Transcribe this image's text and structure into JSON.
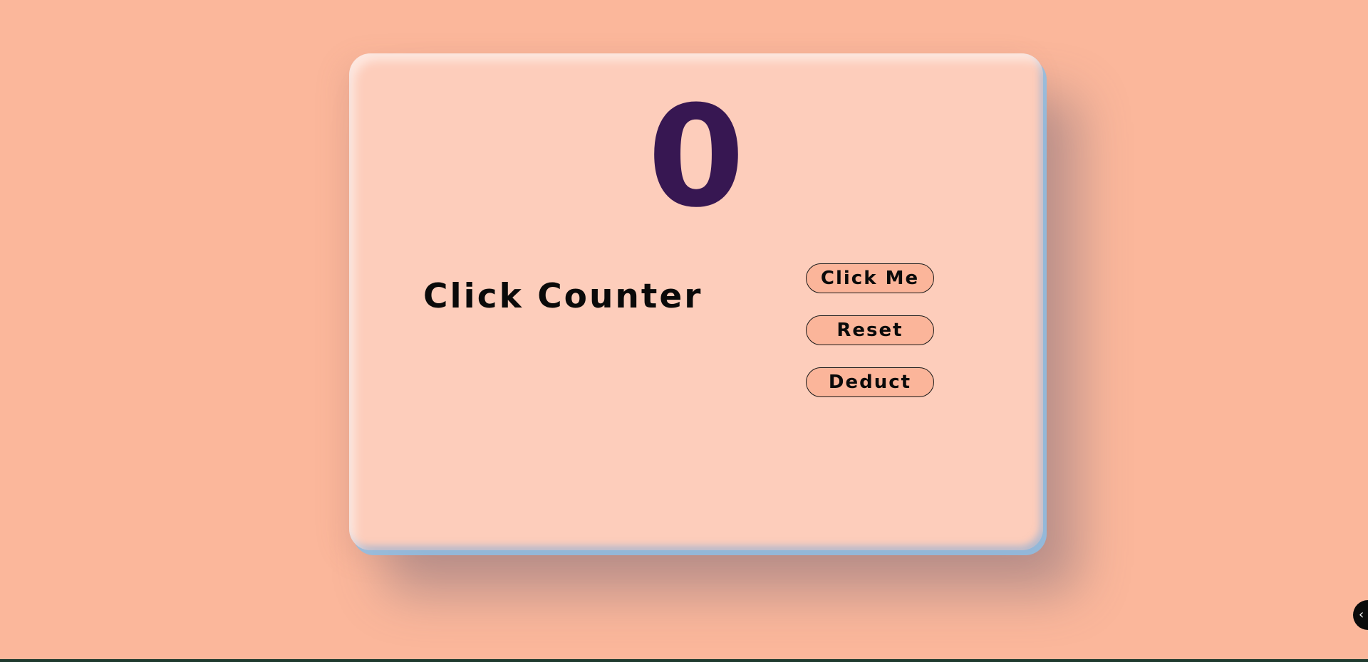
{
  "counter": {
    "value": "0",
    "title": "Click Counter"
  },
  "buttons": {
    "click_label": "Click Me",
    "reset_label": "Reset",
    "deduct_label": "Deduct"
  },
  "floating_button": {
    "icon": "chevron-left-icon",
    "glyph": "‹"
  },
  "colors": {
    "background": "#fbb79b",
    "card": "#fdcdbb",
    "count_text": "#371752",
    "button_fill": "#fbb59a"
  }
}
